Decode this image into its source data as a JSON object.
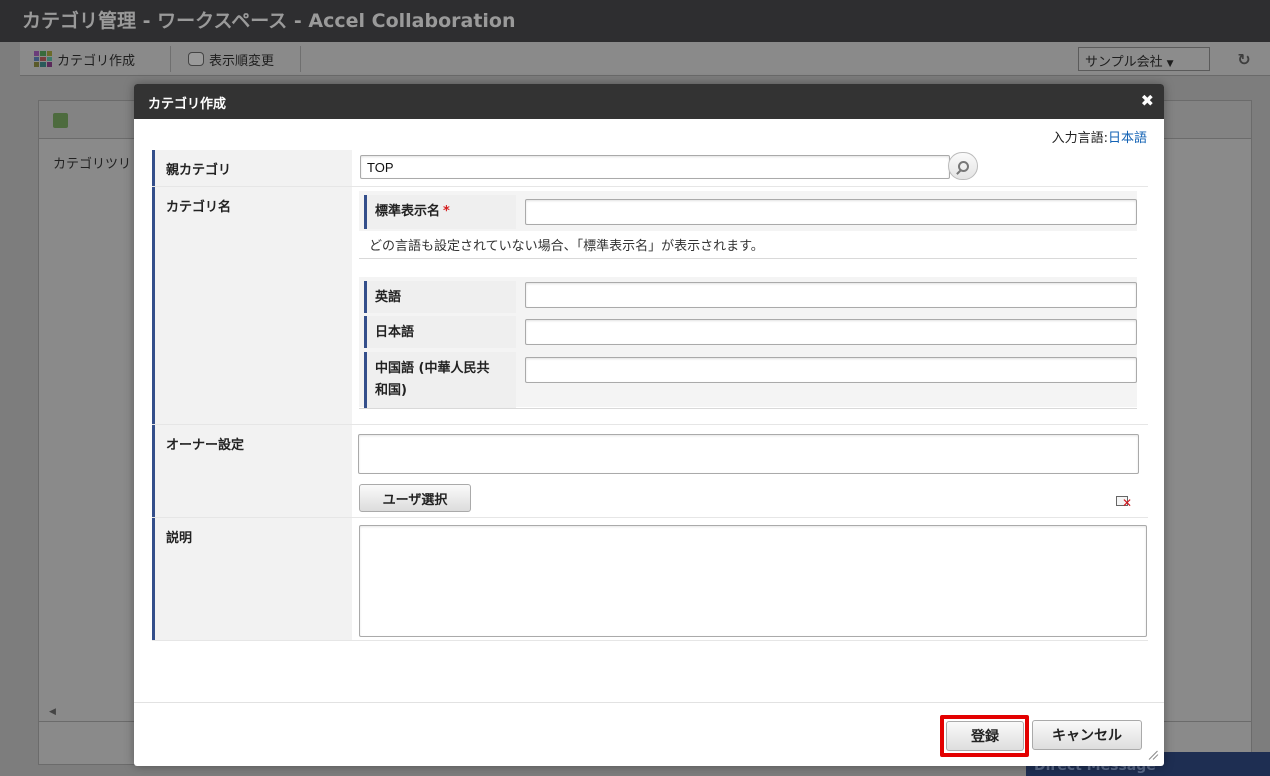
{
  "app": {
    "title": "カテゴリ管理 - ワークスペース - Accel Collaboration",
    "toolbar": {
      "create_label": "カテゴリ作成",
      "reorder_label": "表示順変更"
    },
    "company_select": {
      "selected": "サンプル会社"
    },
    "background": {
      "tree_label": "カテゴリツリ",
      "direct_message": "Direct Message"
    }
  },
  "modal": {
    "title": "カテゴリ作成",
    "input_language": {
      "label": "入力言語:",
      "value": "日本語"
    },
    "parent_category": {
      "label": "親カテゴリ",
      "value": "TOP"
    },
    "category_name": {
      "label": "カテゴリ名",
      "default_label": "標準表示名",
      "required_mark": "*",
      "default_value": "",
      "note": "どの言語も設定されていない場合、「標準表示名」が表示されます。",
      "languages": [
        {
          "label": "英語",
          "value": ""
        },
        {
          "label": "日本語",
          "value": ""
        },
        {
          "label": "中国語 (中華人民共和国)",
          "value": ""
        }
      ]
    },
    "owner": {
      "label": "オーナー設定",
      "value": "",
      "select_button": "ユーザ選択"
    },
    "description": {
      "label": "説明",
      "value": ""
    },
    "buttons": {
      "register": "登録",
      "cancel": "キャンセル"
    }
  },
  "colors": {
    "label_accent": "#344f8b",
    "highlight": "#e30000",
    "link": "#1463b5",
    "modal_header": "#333333"
  }
}
